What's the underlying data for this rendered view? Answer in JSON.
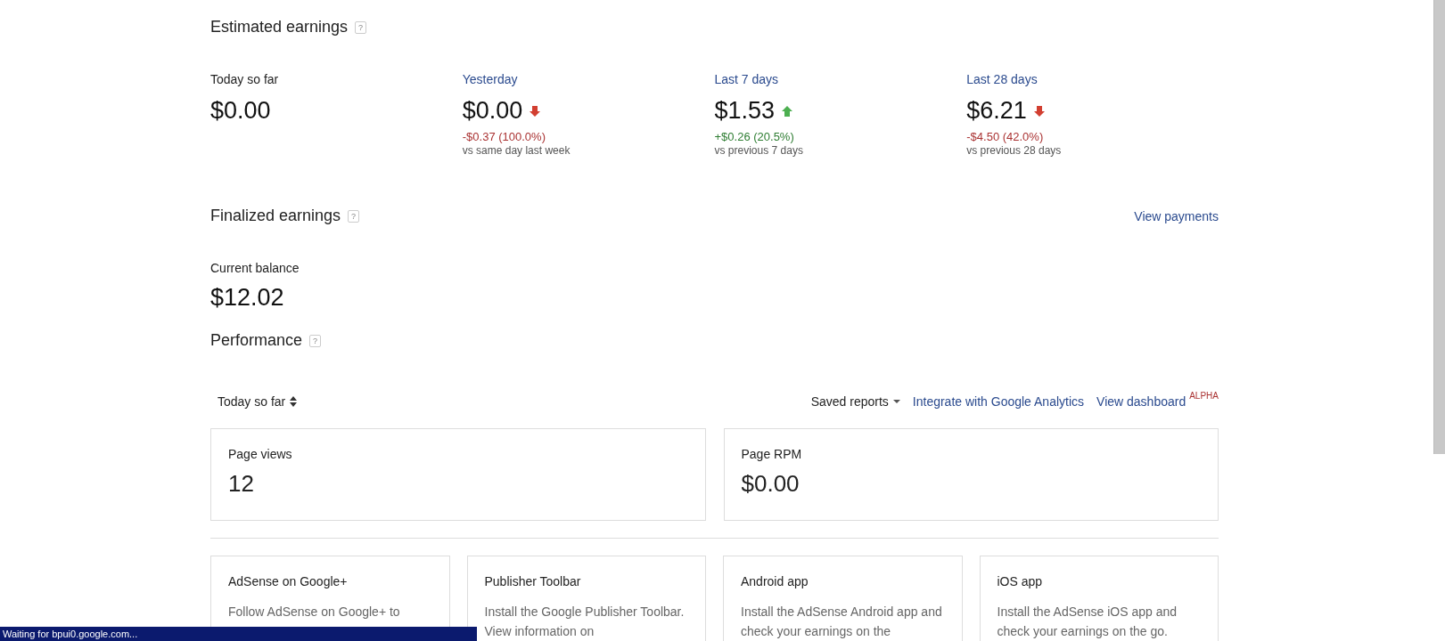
{
  "estimated": {
    "title": "Estimated earnings",
    "help": "?",
    "periods": [
      {
        "label": "Today so far",
        "kind": "plain",
        "value": "$0.00"
      },
      {
        "label": "Yesterday",
        "kind": "link",
        "value": "$0.00",
        "rising": false,
        "change": "-$0.37 (100.0%)",
        "compare": "vs same day last week"
      },
      {
        "label": "Last 7 days",
        "kind": "link",
        "value": "$1.53",
        "rising": true,
        "change": "+$0.26 (20.5%)",
        "compare": "vs previous 7 days"
      },
      {
        "label": "Last 28 days",
        "kind": "link",
        "value": "$6.21",
        "rising": false,
        "change": "-$4.50 (42.0%)",
        "compare": "vs previous 28 days"
      }
    ]
  },
  "finalized": {
    "title": "Finalized earnings",
    "help": "?",
    "link": "View payments",
    "balance_label": "Current balance",
    "balance": "$12.02"
  },
  "performance": {
    "title": "Performance",
    "help": "?",
    "range": "Today so far",
    "saved_reports": "Saved reports",
    "integrate": "Integrate with Google Analytics",
    "dashboard": "View dashboard",
    "badge": "ALPHA",
    "metrics": [
      {
        "label": "Page views",
        "value": "12"
      },
      {
        "label": "Page RPM",
        "value": "$0.00"
      }
    ]
  },
  "promos": [
    {
      "title": "AdSense on Google+",
      "text": "Follow AdSense on Google+ to"
    },
    {
      "title": "Publisher Toolbar",
      "text": "Install the Google Publisher Toolbar. View information on"
    },
    {
      "title": "Android app",
      "text": "Install the AdSense Android app and check your earnings on the"
    },
    {
      "title": "iOS app",
      "text": "Install the AdSense iOS app and check your earnings on the go."
    }
  ],
  "status_bar": "Waiting for bpui0.google.com..."
}
